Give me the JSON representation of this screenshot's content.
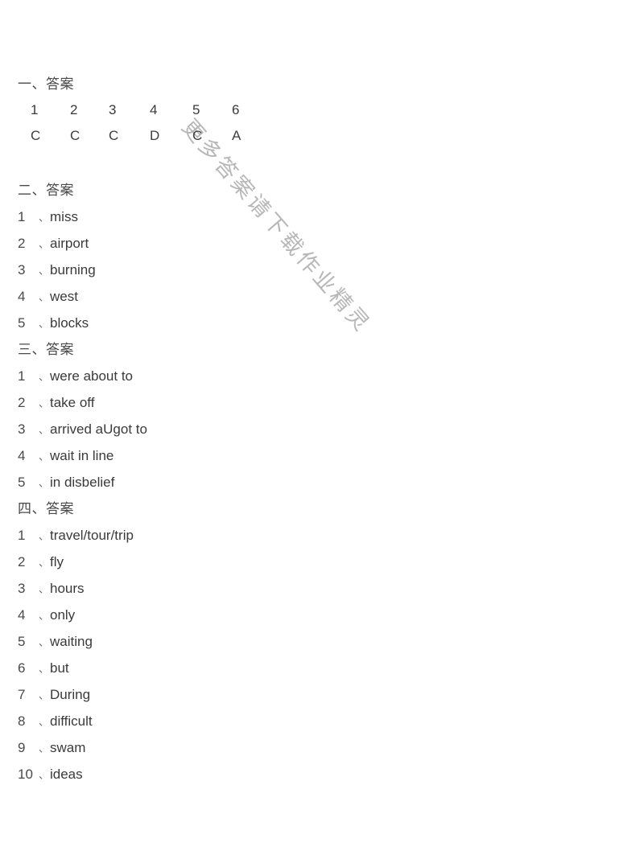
{
  "document": {
    "background_color": "#ffffff",
    "text_color": "#3a3a3a",
    "watermark_color": "#b4b4b4"
  },
  "watermark": {
    "text": "更多答案请下载作业精灵"
  },
  "sections": [
    {
      "heading": "一、答案",
      "type": "grid",
      "columns": [
        "1",
        "2",
        "3",
        "4",
        "5",
        "6"
      ],
      "answers": [
        "C",
        "C",
        "C",
        "D",
        "C",
        "A"
      ]
    },
    {
      "heading": "二、答案",
      "type": "list",
      "items": [
        {
          "num": "1",
          "sep": "、",
          "text": "miss"
        },
        {
          "num": "2",
          "sep": "、",
          "text": "airport"
        },
        {
          "num": "3",
          "sep": "、",
          "text": "burning"
        },
        {
          "num": "4",
          "sep": "、",
          "text": "west"
        },
        {
          "num": "5",
          "sep": "、",
          "text": "blocks"
        }
      ]
    },
    {
      "heading": "三、答案",
      "type": "list",
      "items": [
        {
          "num": "1",
          "sep": "、",
          "text": "were about to"
        },
        {
          "num": "2",
          "sep": "、",
          "text": "take off"
        },
        {
          "num": "3",
          "sep": "、",
          "text": "arrived aUgot to"
        },
        {
          "num": "4",
          "sep": "、",
          "text": "wait in line"
        },
        {
          "num": "5",
          "sep": "、",
          "text": "in disbelief"
        }
      ]
    },
    {
      "heading": "四、答案",
      "type": "list",
      "items": [
        {
          "num": "1",
          "sep": "、",
          "text": "travel/tour/trip"
        },
        {
          "num": "2",
          "sep": "、",
          "text": "fly"
        },
        {
          "num": "3",
          "sep": "、",
          "text": "hours"
        },
        {
          "num": "4",
          "sep": "、",
          "text": "only"
        },
        {
          "num": "5",
          "sep": "、",
          "text": "waiting"
        },
        {
          "num": "6",
          "sep": "、",
          "text": "but"
        },
        {
          "num": "7",
          "sep": "、",
          "text": "During"
        },
        {
          "num": "8",
          "sep": "、",
          "text": "difficult"
        },
        {
          "num": "9",
          "sep": "、",
          "text": "swam"
        },
        {
          "num": "10",
          "sep": "、",
          "text": "ideas"
        }
      ]
    }
  ]
}
